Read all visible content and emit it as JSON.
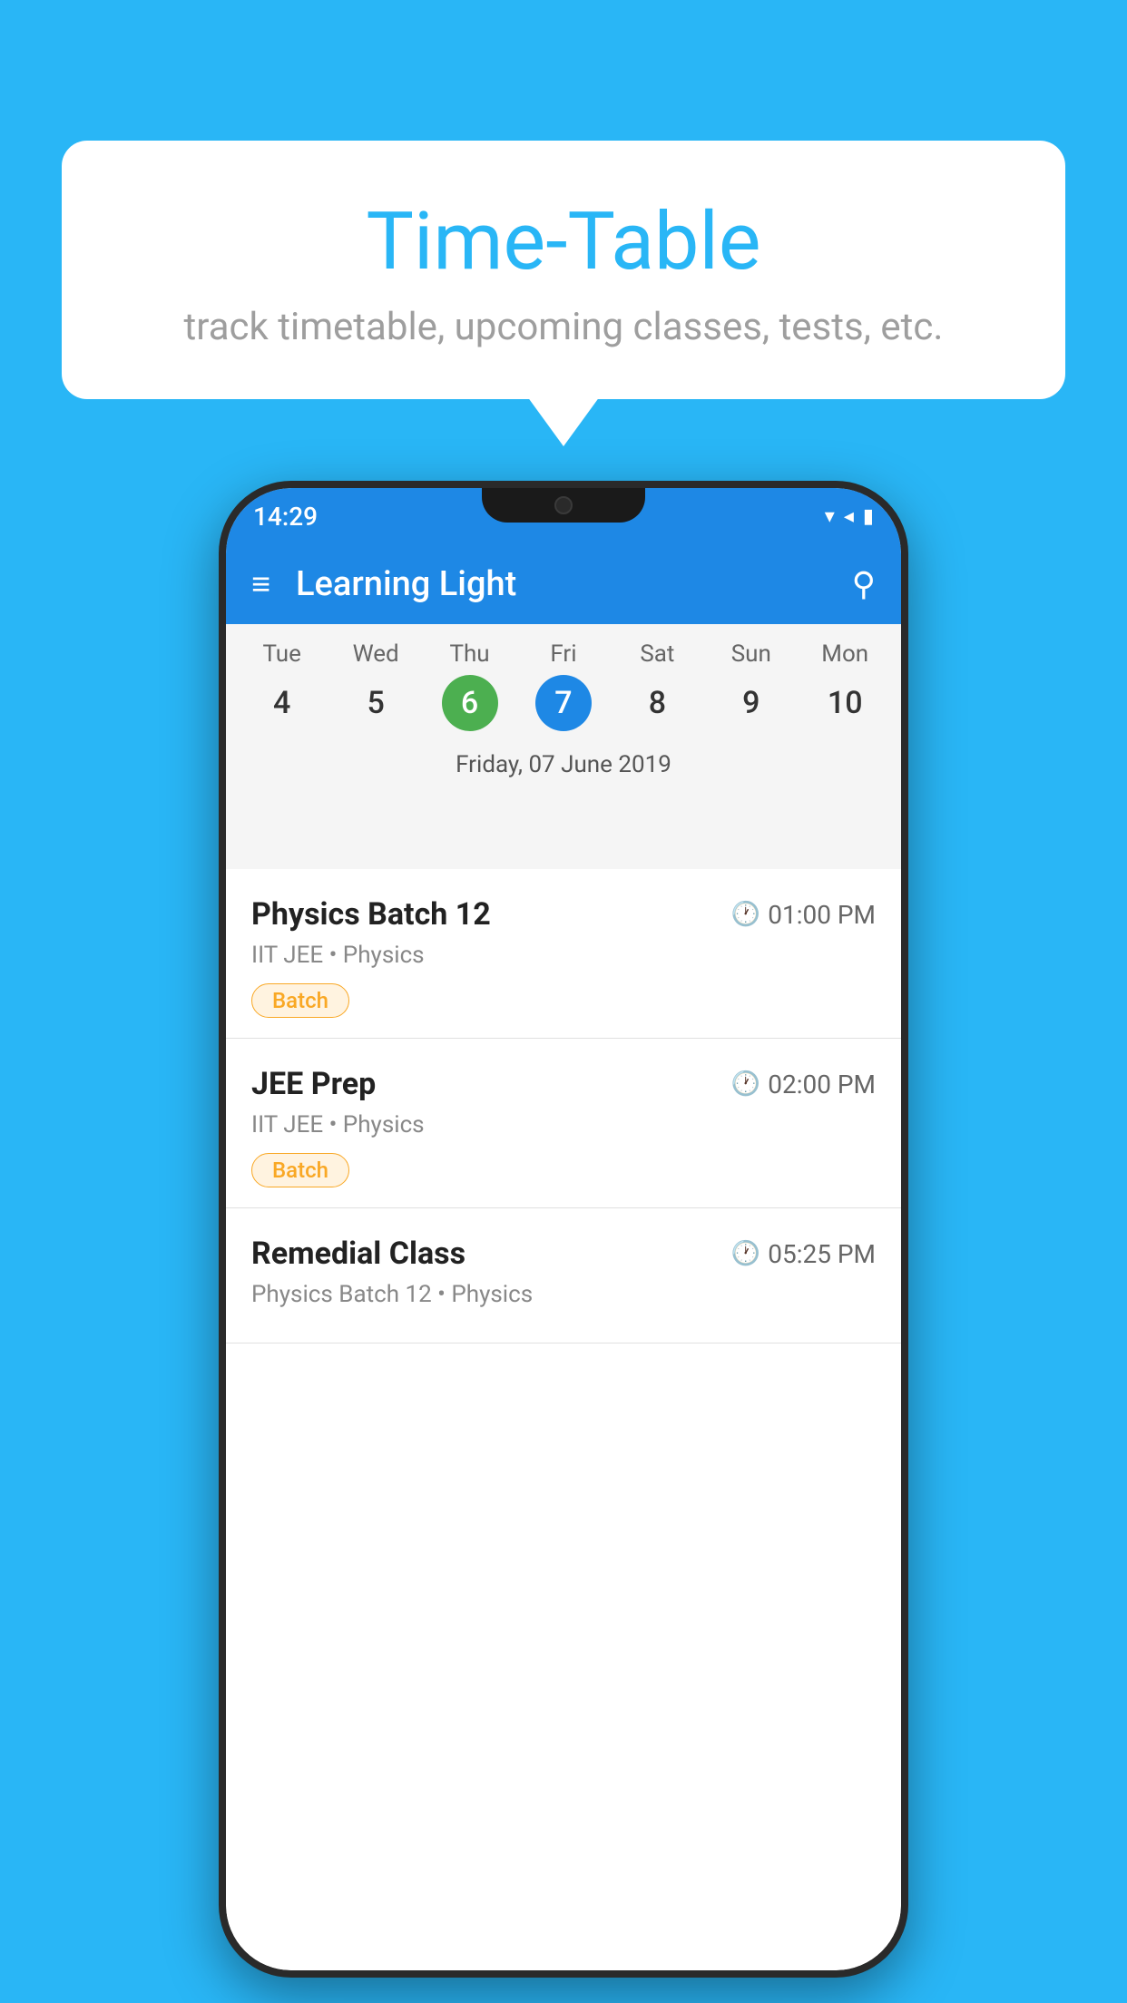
{
  "background_color": "#29b6f6",
  "bubble": {
    "title": "Time-Table",
    "subtitle": "track timetable, upcoming classes, tests, etc."
  },
  "phone": {
    "status_bar": {
      "time": "14:29",
      "wifi_icon": "▾",
      "signal_icon": "◂",
      "battery_icon": "▮"
    },
    "app_bar": {
      "title": "Learning Light",
      "menu_icon": "≡",
      "search_icon": "⌕"
    },
    "calendar": {
      "days": [
        {
          "label": "Tue",
          "number": "4",
          "state": "normal"
        },
        {
          "label": "Wed",
          "number": "5",
          "state": "normal"
        },
        {
          "label": "Thu",
          "number": "6",
          "state": "today"
        },
        {
          "label": "Fri",
          "number": "7",
          "state": "selected"
        },
        {
          "label": "Sat",
          "number": "8",
          "state": "normal"
        },
        {
          "label": "Sun",
          "number": "9",
          "state": "normal"
        },
        {
          "label": "Mon",
          "number": "10",
          "state": "normal"
        }
      ],
      "selected_date_label": "Friday, 07 June 2019"
    },
    "schedule": [
      {
        "title": "Physics Batch 12",
        "time": "01:00 PM",
        "subtitle": "IIT JEE • Physics",
        "badge": "Batch"
      },
      {
        "title": "JEE Prep",
        "time": "02:00 PM",
        "subtitle": "IIT JEE • Physics",
        "badge": "Batch"
      },
      {
        "title": "Remedial Class",
        "time": "05:25 PM",
        "subtitle": "Physics Batch 12 • Physics",
        "badge": ""
      }
    ]
  }
}
